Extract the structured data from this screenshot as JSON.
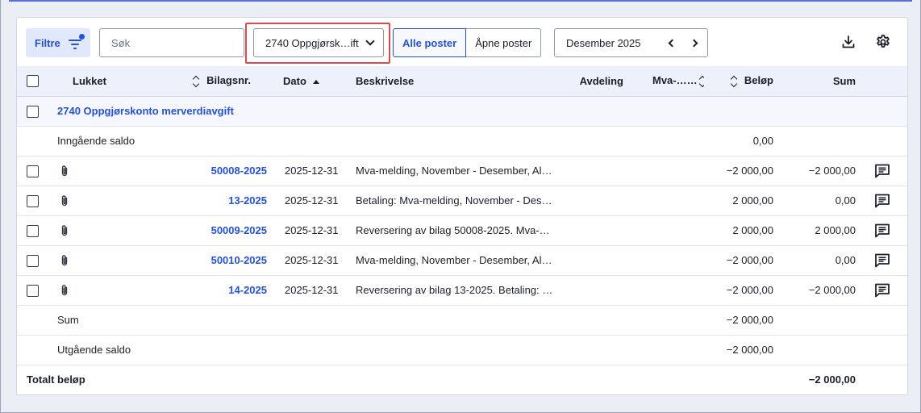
{
  "toolbar": {
    "filter_label": "Filtre",
    "search_placeholder": "Søk",
    "account_value": "2740 Oppgjørsk…ift",
    "toggle": [
      "Alle poster",
      "Åpne poster"
    ],
    "period_label": "Desember 2025"
  },
  "columns": {
    "closed": "Lukket",
    "voucher": "Bilagsnr.",
    "date": "Dato",
    "description": "Beskrivelse",
    "department": "Avdeling",
    "vat": "Mva-…",
    "amount": "Beløp",
    "sum": "Sum"
  },
  "group": {
    "label": "2740 Oppgjørskonto merverdiavgift",
    "opening_label": "Inngående saldo",
    "opening_amount": "0,00"
  },
  "rows": [
    {
      "voucher": "50008-2025",
      "date": "2025-12-31",
      "description": "Mva-melding, November - Desember, Al…",
      "amount": "−2 000,00",
      "sum": "−2 000,00"
    },
    {
      "voucher": "13-2025",
      "date": "2025-12-31",
      "description": "Betaling: Mva-melding, November - Dese…",
      "amount": "2 000,00",
      "sum": "0,00"
    },
    {
      "voucher": "50009-2025",
      "date": "2025-12-31",
      "description": "Reversering av bilag 50008-2025. Mva-…",
      "amount": "2 000,00",
      "sum": "2 000,00"
    },
    {
      "voucher": "50010-2025",
      "date": "2025-12-31",
      "description": "Mva-melding, November - Desember, Al…",
      "amount": "−2 000,00",
      "sum": "0,00"
    },
    {
      "voucher": "14-2025",
      "date": "2025-12-31",
      "description": "Reversering av bilag 13-2025. Betaling: …",
      "amount": "−2 000,00",
      "sum": "−2 000,00"
    }
  ],
  "summary": {
    "sum_label": "Sum",
    "sum_amount": "−2 000,00",
    "closing_label": "Utgående saldo",
    "closing_amount": "−2 000,00"
  },
  "footer": {
    "total_label": "Totalt beløp",
    "total_sum": "−2 000,00"
  },
  "colors": {
    "accent": "#2451d6",
    "highlight": "#d94a4e"
  }
}
